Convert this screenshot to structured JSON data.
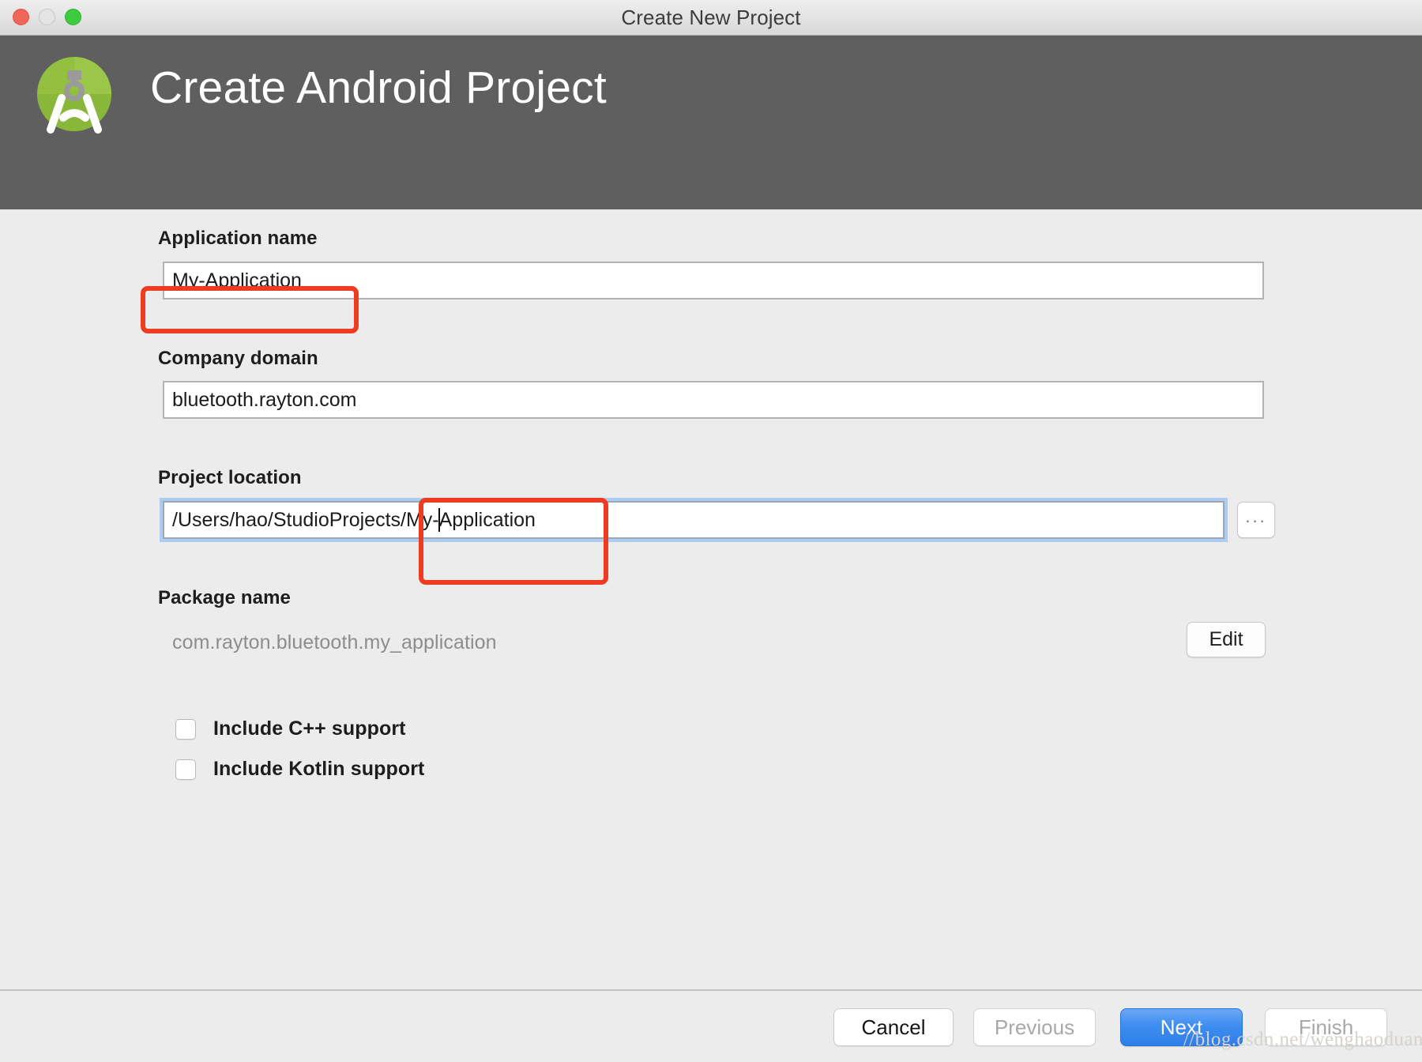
{
  "window": {
    "title": "Create New Project",
    "controls": [
      "close",
      "minimize",
      "maximize"
    ]
  },
  "banner": {
    "title": "Create Android Project",
    "logo_alt": "android-studio-logo",
    "background_color": "#5f5f5f"
  },
  "form": {
    "application_name": {
      "label": "Application name",
      "value": "My-Application",
      "placeholder": "Application name"
    },
    "company_domain": {
      "label": "Company domain",
      "value": "bluetooth.rayton.com",
      "placeholder": "Company domain"
    },
    "project_location": {
      "label": "Project location",
      "value_before_caret": "/Users/hao/StudioProjects/My-",
      "value_after_caret": "Application",
      "full_value": "/Users/hao/StudioProjects/My-Application",
      "placeholder": "Project location",
      "browse_label": "..."
    },
    "package_name": {
      "label": "Package name",
      "value": "com.rayton.bluetooth.my_application",
      "edit_label": "Edit"
    },
    "checkboxes": [
      {
        "label": "Include C++ support",
        "checked": false
      },
      {
        "label": "Include Kotlin support",
        "checked": false
      }
    ]
  },
  "footer": {
    "buttons": [
      {
        "label": "Cancel",
        "state": "enabled",
        "style": "default"
      },
      {
        "label": "Previous",
        "state": "disabled",
        "style": "disabled"
      },
      {
        "label": "Next",
        "state": "enabled",
        "style": "primary"
      },
      {
        "label": "Finish",
        "state": "disabled",
        "style": "disabled"
      }
    ]
  },
  "watermark": {
    "text": "//blog.csdn.net/wenghaoduan"
  },
  "annotations": [
    {
      "name": "application-name-highlight",
      "color": "#ef3c20"
    },
    {
      "name": "project-location-suffix-highlight",
      "color": "#ef3c20"
    }
  ],
  "colors": {
    "accent": "#3d8cf0",
    "annotation": "#ef3c20",
    "banner_bg": "#5f5f5f",
    "page_bg": "#ececec",
    "focus_ring": "#aecbf0"
  }
}
